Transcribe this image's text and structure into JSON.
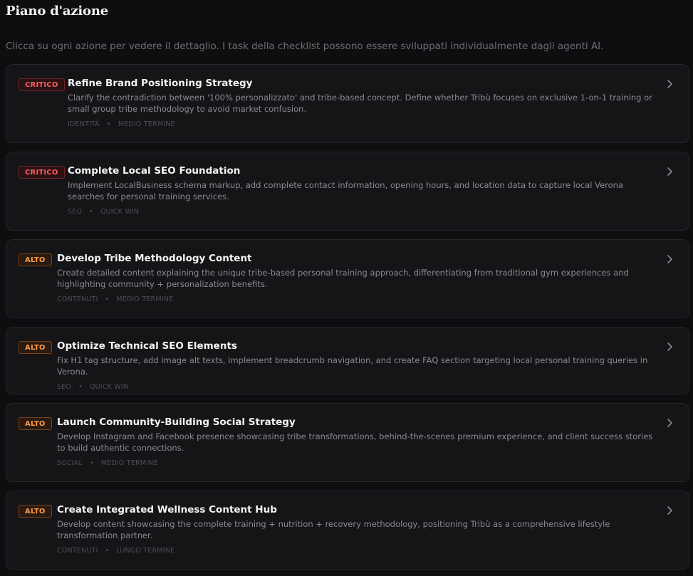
{
  "page": {
    "title": "Piano d'azione",
    "subtitle": "Clicca su ogni azione per vedere il dettaglio. I task della checklist possono essere sviluppati individualmente dagli agenti AI."
  },
  "actions": [
    {
      "priority": "CRITICO",
      "title": "Refine Brand Positioning Strategy",
      "description": "Clarify the contradiction between '100% personalizzato' and tribe-based concept. Define whether Tribù focuses on exclusive 1-on-1 training or small group tribe methodology to avoid market confusion.",
      "category": "IDENTITÀ",
      "timeframe": "MEDIO TERMINE"
    },
    {
      "priority": "CRITICO",
      "title": "Complete Local SEO Foundation",
      "description": "Implement LocalBusiness schema markup, add complete contact information, opening hours, and location data to capture local Verona searches for personal training services.",
      "category": "SEO",
      "timeframe": "QUICK WIN"
    },
    {
      "priority": "ALTO",
      "title": "Develop Tribe Methodology Content",
      "description": "Create detailed content explaining the unique tribe-based personal training approach, differentiating from traditional gym experiences and highlighting community + personalization benefits.",
      "category": "CONTENUTI",
      "timeframe": "MEDIO TERMINE"
    },
    {
      "priority": "ALTO",
      "title": "Optimize Technical SEO Elements",
      "description": "Fix H1 tag structure, add image alt texts, implement breadcrumb navigation, and create FAQ section targeting local personal training queries in Verona.",
      "category": "SEO",
      "timeframe": "QUICK WIN"
    },
    {
      "priority": "ALTO",
      "title": "Launch Community-Building Social Strategy",
      "description": "Develop Instagram and Facebook presence showcasing tribe transformations, behind-the-scenes premium experience, and client success stories to build authentic connections.",
      "category": "SOCIAL",
      "timeframe": "MEDIO TERMINE"
    },
    {
      "priority": "ALTO",
      "title": "Create Integrated Wellness Content Hub",
      "description": "Develop content showcasing the complete training + nutrition + recovery methodology, positioning Tribù as a comprehensive lifestyle transformation partner.",
      "category": "CONTENUTI",
      "timeframe": "LUNGO TERMINE"
    }
  ],
  "icons": {
    "chevron": "chevron-right-icon"
  },
  "colors": {
    "critico": "#ff5c5c",
    "alto": "#ff9a4a",
    "background": "#0e0e10",
    "card": "#151518"
  }
}
